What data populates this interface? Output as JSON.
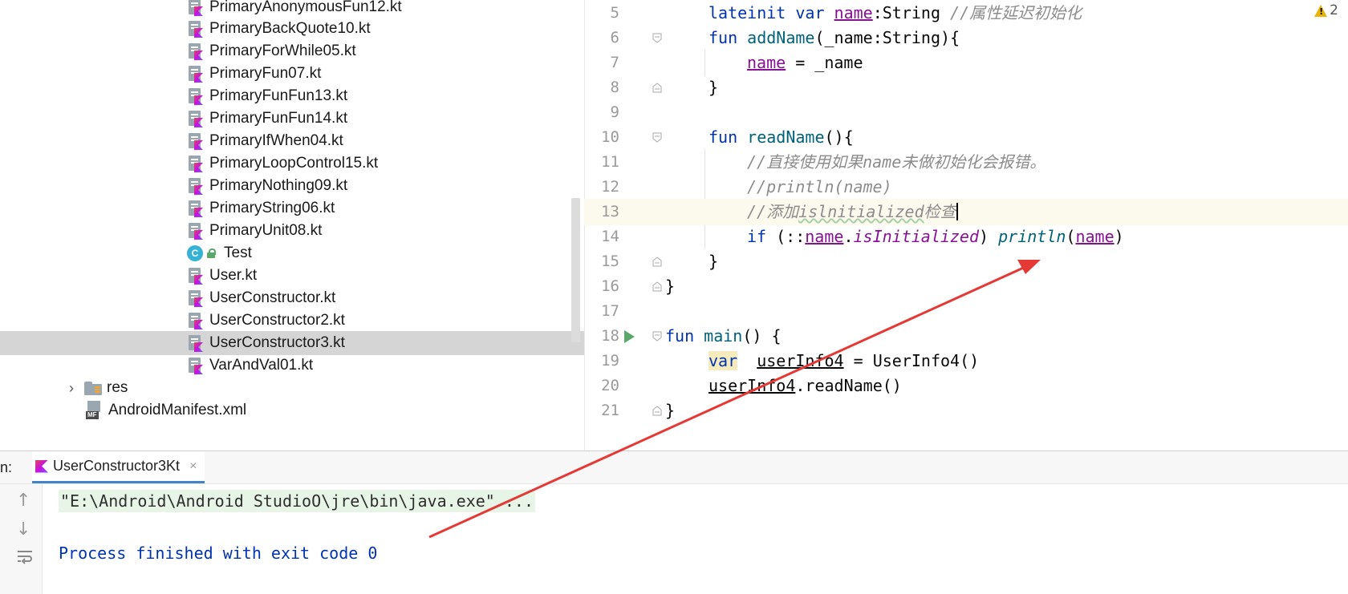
{
  "project_tree": {
    "items": [
      {
        "label": "PrimaryAnonymousFun12.kt",
        "type": "kotlin"
      },
      {
        "label": "PrimaryBackQuote10.kt",
        "type": "kotlin"
      },
      {
        "label": "PrimaryForWhile05.kt",
        "type": "kotlin"
      },
      {
        "label": "PrimaryFun07.kt",
        "type": "kotlin"
      },
      {
        "label": "PrimaryFunFun13.kt",
        "type": "kotlin"
      },
      {
        "label": "PrimaryFunFun14.kt",
        "type": "kotlin"
      },
      {
        "label": "PrimaryIfWhen04.kt",
        "type": "kotlin"
      },
      {
        "label": "PrimaryLoopControl15.kt",
        "type": "kotlin"
      },
      {
        "label": "PrimaryNothing09.kt",
        "type": "kotlin"
      },
      {
        "label": "PrimaryString06.kt",
        "type": "kotlin"
      },
      {
        "label": "PrimaryUnit08.kt",
        "type": "kotlin"
      },
      {
        "label": "Test",
        "type": "class",
        "badge": "C"
      },
      {
        "label": "User.kt",
        "type": "kotlin"
      },
      {
        "label": "UserConstructor.kt",
        "type": "kotlin"
      },
      {
        "label": "UserConstructor2.kt",
        "type": "kotlin"
      },
      {
        "label": "UserConstructor3.kt",
        "type": "kotlin",
        "selected": true
      },
      {
        "label": "VarAndVal01.kt",
        "type": "kotlin"
      }
    ],
    "res_folder": "res",
    "manifest": {
      "label": "AndroidManifest.xml",
      "badge": "MF"
    }
  },
  "editor": {
    "warning_count": "2",
    "line_numbers": [
      "5",
      "6",
      "7",
      "8",
      "9",
      "10",
      "11",
      "12",
      "13",
      "14",
      "15",
      "16",
      "17",
      "18",
      "19",
      "20",
      "21"
    ],
    "lines": {
      "l5": {
        "kw1": "lateinit",
        "kw2": "var",
        "prop": "name",
        "rest": ":String ",
        "comment": "//属性延迟初始化"
      },
      "l6": {
        "kw": "fun",
        "fn": "addName",
        "rest": "(_name:String){"
      },
      "l7": {
        "prop": "name",
        "rest": " = _name"
      },
      "l8": {
        "text": "}"
      },
      "l10": {
        "kw": "fun",
        "fn": "readName",
        "rest": "(){"
      },
      "l11": {
        "comment": "//直接使用如果name未做初始化会报错。"
      },
      "l12": {
        "comment": "//println(name)"
      },
      "l13": {
        "comment_a": "//添加",
        "comment_b": "islnitialized",
        "comment_c": "检查"
      },
      "l14": {
        "kw": "if",
        "p1": " (::",
        "prop": "name",
        "dot": ".",
        "ext": "isInitialized",
        "p2": ") ",
        "fn": "println",
        "p3": "(",
        "arg": "name",
        "p4": ")"
      },
      "l15": {
        "text": "}"
      },
      "l16": {
        "text": "}"
      },
      "l18": {
        "kw": "fun",
        "fn": "main",
        "rest": "() {"
      },
      "l19": {
        "kw": "var",
        "sp": "  ",
        "var": "userInfo4",
        "rest": " = UserInfo4()"
      },
      "l20": {
        "var": "userInfo4",
        "rest": ".readName()"
      },
      "l21": {
        "text": "}"
      }
    }
  },
  "run_panel": {
    "prefix": "n:",
    "tab_label": "UserConstructor3Kt",
    "tab_close": "×",
    "command_line": "\"E:\\Android\\Android StudioO\\jre\\bin\\java.exe\" ...",
    "exit_message": "Process finished with exit code 0",
    "toolbar": [
      "up-arrow-icon",
      "down-arrow-icon",
      "soft-wrap-icon"
    ]
  },
  "colors": {
    "keyword": "#0033b3",
    "function": "#00627a",
    "property": "#871094",
    "comment": "#8c8c8c",
    "annotation_arrow": "#e53935",
    "selection": "#d5d5d5"
  }
}
